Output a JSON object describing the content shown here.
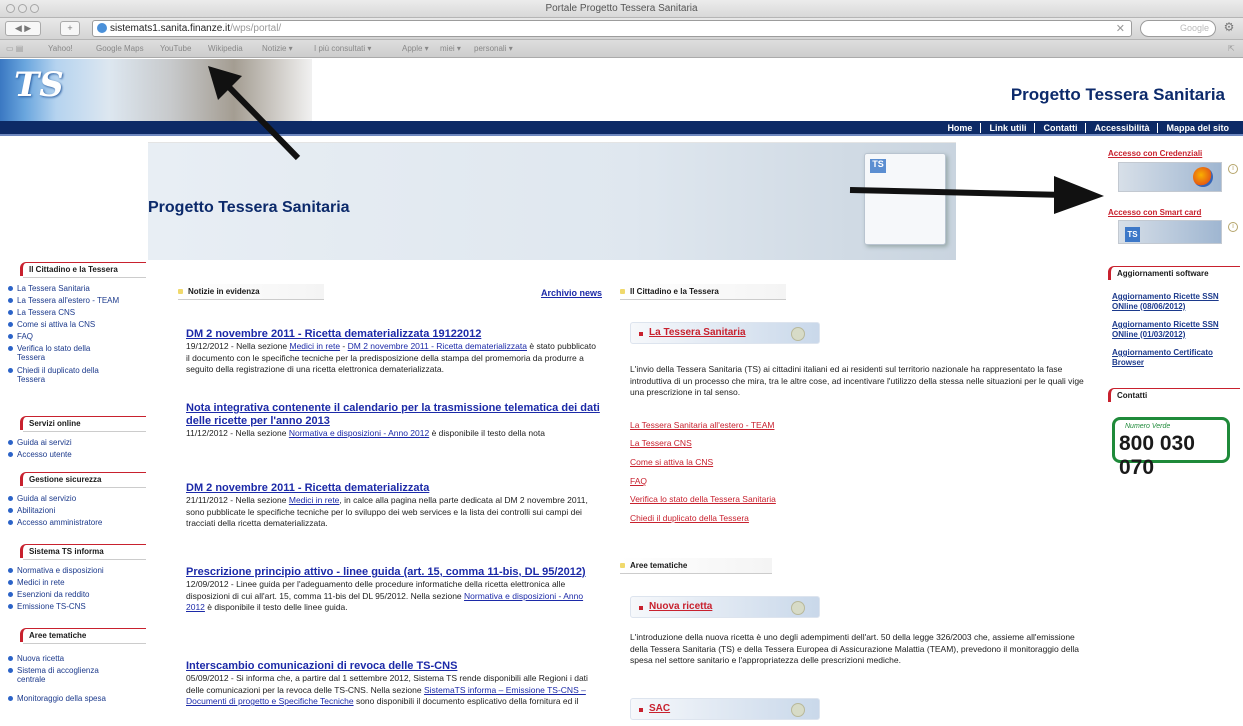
{
  "browser": {
    "window_title": "Portale Progetto Tessera Sanitaria",
    "url_host": "sistemats1.sanita.finanze.it",
    "url_path": "/wps/portal/",
    "search_placeholder": "Google",
    "back_label": "◀ ▶",
    "add_label": "+",
    "stop_label": "✕",
    "bookmarks": [
      "Yahoo!",
      "Google Maps",
      "YouTube",
      "Wikipedia",
      "Notizie ▾",
      "I più consultati ▾",
      "Apple ▾",
      "miei ▾",
      "personali ▾"
    ]
  },
  "header": {
    "logo_text": "TS",
    "site_title": "Progetto Tessera Sanitaria",
    "topnav": [
      "Home",
      "Link utili",
      "Contatti",
      "Accessibilità",
      "Mappa del sito"
    ]
  },
  "hero": {
    "title": "Progetto Tessera Sanitaria",
    "login_credentials": "Accesso con Credenziali",
    "login_smartcard": "Accesso con Smart card",
    "card_logo": "TS",
    "info_symbol": "i"
  },
  "sidebar": {
    "sections": [
      {
        "title": "Il Cittadino e la Tessera",
        "items": [
          "La Tessera Sanitaria",
          "La Tessera all'estero - TEAM",
          "La Tessera CNS",
          "Come si attiva la CNS",
          "FAQ",
          "Verifica lo stato della Tessera",
          "Chiedi il duplicato della Tessera"
        ]
      },
      {
        "title": "Servizi online",
        "items": [
          "Guida ai servizi",
          "Accesso utente"
        ]
      },
      {
        "title": "Gestione sicurezza",
        "items": [
          "Guida al servizio",
          "Abilitazioni",
          "Accesso amministratore"
        ]
      },
      {
        "title": "Sistema TS informa",
        "items": [
          "Normativa e disposizioni",
          "Medici in rete",
          "Esenzioni da reddito",
          "Emissione TS-CNS"
        ]
      },
      {
        "title": "Aree tematiche",
        "items": [
          "Nuova ricetta",
          "Sistema di accoglienza centrale",
          "Monitoraggio della spesa"
        ]
      }
    ]
  },
  "news": {
    "tab_label": "Notizie in evidenza",
    "archive_label": "Archivio news",
    "items": [
      {
        "title": "DM 2 novembre 2011 - Ricetta dematerializzata 19122012",
        "date": "19/12/2012 - Nella sezione ",
        "link1": "Medici in rete",
        "sep": " - ",
        "link2": "DM 2 novembre 2011 - Ricetta dematerializzata",
        "rest": " è stato pubblicato il documento con le specifiche tecniche per la predisposizione della stampa del promemoria da produrre a seguito della registrazione di una ricetta elettronica dematerializzata."
      },
      {
        "title": "Nota integrativa contenente il calendario per la trasmissione telematica dei dati delle ricette per l'anno 2013",
        "date": "11/12/2012 - Nella sezione ",
        "link1": "Normativa e disposizioni - Anno 2012",
        "rest": " è disponibile il testo della nota"
      },
      {
        "title": "DM 2 novembre 2011 - Ricetta dematerializzata",
        "date": "21/11/2012 - Nella sezione ",
        "link1": "Medici in rete",
        "rest": ", in calce alla pagina nella parte dedicata al DM 2 novembre 2011, sono pubblicate le specifiche tecniche per lo sviluppo dei web services e la lista dei controlli sui campi dei tracciati della ricetta dematerializzata."
      },
      {
        "title": "Prescrizione principio attivo - linee guida (art. 15, comma 11-bis, DL 95/2012)",
        "date": "12/09/2012 - Linee guida per l'adeguamento delle procedure informatiche della ricetta elettronica alle disposizioni di cui all'art. 15, comma 11-bis del DL 95/2012. Nella sezione ",
        "link1": "Normativa e disposizioni - Anno 2012",
        "rest": " è disponibile il testo delle linee guida."
      },
      {
        "title": "Interscambio comunicazioni di revoca delle TS-CNS",
        "date": "05/09/2012 - Si informa che, a partire dal 1 settembre 2012, Sistema TS rende disponibili alle Regioni i dati delle comunicazioni per la revoca delle TS-CNS. Nella sezione ",
        "link1": "SistemaTS informa – Emissione TS-CNS – Documenti di progetto e Specifiche Tecniche",
        "rest": " sono disponibili il documento esplicativo della fornitura ed il"
      }
    ]
  },
  "center": {
    "tab1": "Il Cittadino e la Tessera",
    "box1_title": "La Tessera Sanitaria",
    "box1_text": "L'invio della Tessera Sanitaria (TS) ai cittadini italiani ed ai residenti sul territorio nazionale ha rappresentato la fase introduttiva di un processo che mira, tra le altre cose, ad incentivare l'utilizzo della stessa nelle situazioni per le quali vige una prescrizione in tal senso.",
    "links": [
      "La Tessera Sanitaria all'estero - TEAM",
      "La Tessera CNS",
      "Come si attiva la CNS",
      "FAQ",
      "Verifica lo stato della Tessera Sanitaria",
      "Chiedi il duplicato della Tessera"
    ],
    "tab2": "Aree tematiche",
    "box2_title": "Nuova ricetta",
    "box2_text": "L'introduzione della nuova ricetta è uno degli adempimenti dell'art. 50 della legge 326/2003 che, assieme all'emissione della Tessera Sanitaria (TS) e della Tessera Europea di Assicurazione Malattia (TEAM), prevedono il monitoraggio della spesa nel settore sanitario e l'appropriatezza delle prescrizioni mediche.",
    "box3_title": "SAC"
  },
  "right": {
    "updates_title": "Aggiornamenti software",
    "updates": [
      "Aggiornamento Ricette SSN ONline (08/06/2012)",
      "Aggiornamento Ricette SSN ONline (01/03/2012)",
      "Aggiornamento Certificato Browser"
    ],
    "contacts_title": "Contatti",
    "numero_verde_label": "Numero Verde",
    "numero_verde": "800 030 070"
  }
}
